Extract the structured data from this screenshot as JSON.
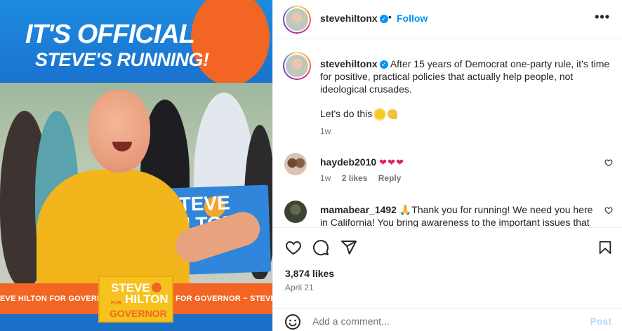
{
  "media": {
    "headline_line1": "IT'S OFFICIAL",
    "headline_line2": "STEVE'S RUNNING!",
    "sign_text": "TEVE\nILTON\nNOR",
    "banner_left": "EVE HILTON FOR GOVERN",
    "banner_right": "FOR GOVERNOR ~ STEVE",
    "logo_steve": "STEVE",
    "logo_for": "FOR",
    "logo_hilton": "HILTON",
    "logo_governor": "GOVERNOR",
    "colors": {
      "blue": "#1a72cf",
      "orange": "#f26522",
      "yellow": "#f2b51c"
    }
  },
  "header": {
    "username": "stevehiltonx",
    "verified_icon": "verified-badge-icon",
    "separator": "•",
    "follow_label": "Follow",
    "more_label": "•••"
  },
  "caption": {
    "username": "stevehiltonx",
    "text": "After 15 years of Democrat one-party rule, it's time for positive, practical policies that actually help people, not ideological crusades.",
    "text2": "Let's do this",
    "emojis": [
      "sun-emoji",
      "flexed-biceps-emoji"
    ],
    "time": "1w"
  },
  "comments": [
    {
      "username": "haydeb2010",
      "text": "",
      "hearts": "❤❤❤",
      "time": "1w",
      "likes": "2 likes",
      "reply": "Reply"
    },
    {
      "username": "mamabear_1492",
      "text": "🙏Thank you for running! We need you here in California! You bring awareness to the important issues that affect us all here in California!🙏 ❤"
    }
  ],
  "actions": {
    "likes": "3,874 likes",
    "date": "April 21"
  },
  "add_comment": {
    "placeholder": "Add a comment...",
    "post_label": "Post"
  },
  "icons": [
    "heart-icon",
    "comment-icon",
    "share-icon",
    "bookmark-icon",
    "emoji-icon",
    "more-options-icon"
  ],
  "colors": {
    "link": "#0095f6",
    "muted": "#737373",
    "text": "#262626",
    "heart": "#e0245e"
  }
}
